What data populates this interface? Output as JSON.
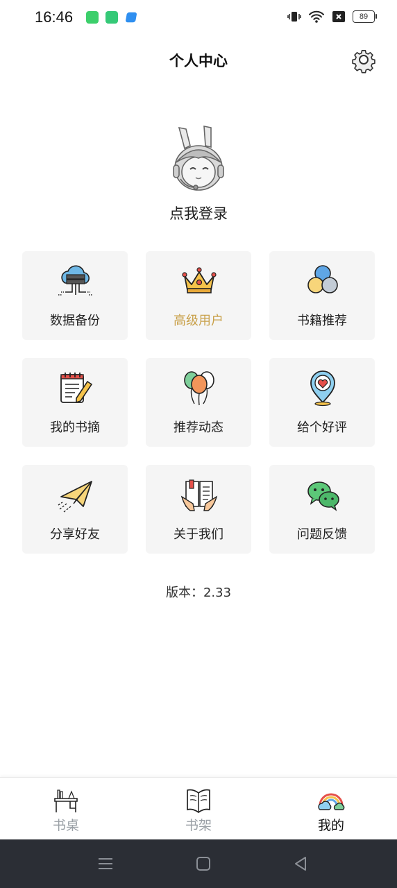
{
  "status_bar": {
    "time": "16:46",
    "battery": "89"
  },
  "header": {
    "title": "个人中心"
  },
  "profile": {
    "login_text": "点我登录"
  },
  "menu": [
    {
      "label": "数据备份",
      "icon": "cloud-server-icon"
    },
    {
      "label": "高级用户",
      "icon": "crown-icon",
      "color": "#c9a14a"
    },
    {
      "label": "书籍推荐",
      "icon": "circles-icon"
    },
    {
      "label": "我的书摘",
      "icon": "notepad-pencil-icon"
    },
    {
      "label": "推荐动态",
      "icon": "balloons-icon"
    },
    {
      "label": "给个好评",
      "icon": "heart-pin-icon"
    },
    {
      "label": "分享好友",
      "icon": "paper-plane-icon"
    },
    {
      "label": "关于我们",
      "icon": "open-book-hands-icon"
    },
    {
      "label": "问题反馈",
      "icon": "wechat-chat-icon"
    }
  ],
  "version": "版本：2.33",
  "bottom_nav": [
    {
      "label": "书桌",
      "icon": "desk-icon",
      "active": false
    },
    {
      "label": "书架",
      "icon": "bookshelf-icon",
      "active": false
    },
    {
      "label": "我的",
      "icon": "rainbow-cloud-icon",
      "active": true
    }
  ],
  "colors": {
    "accent_gold": "#c9a14a",
    "card_bg": "#f5f5f5",
    "inactive_nav": "#9aa0a6",
    "system_bar": "#2b2e35"
  }
}
